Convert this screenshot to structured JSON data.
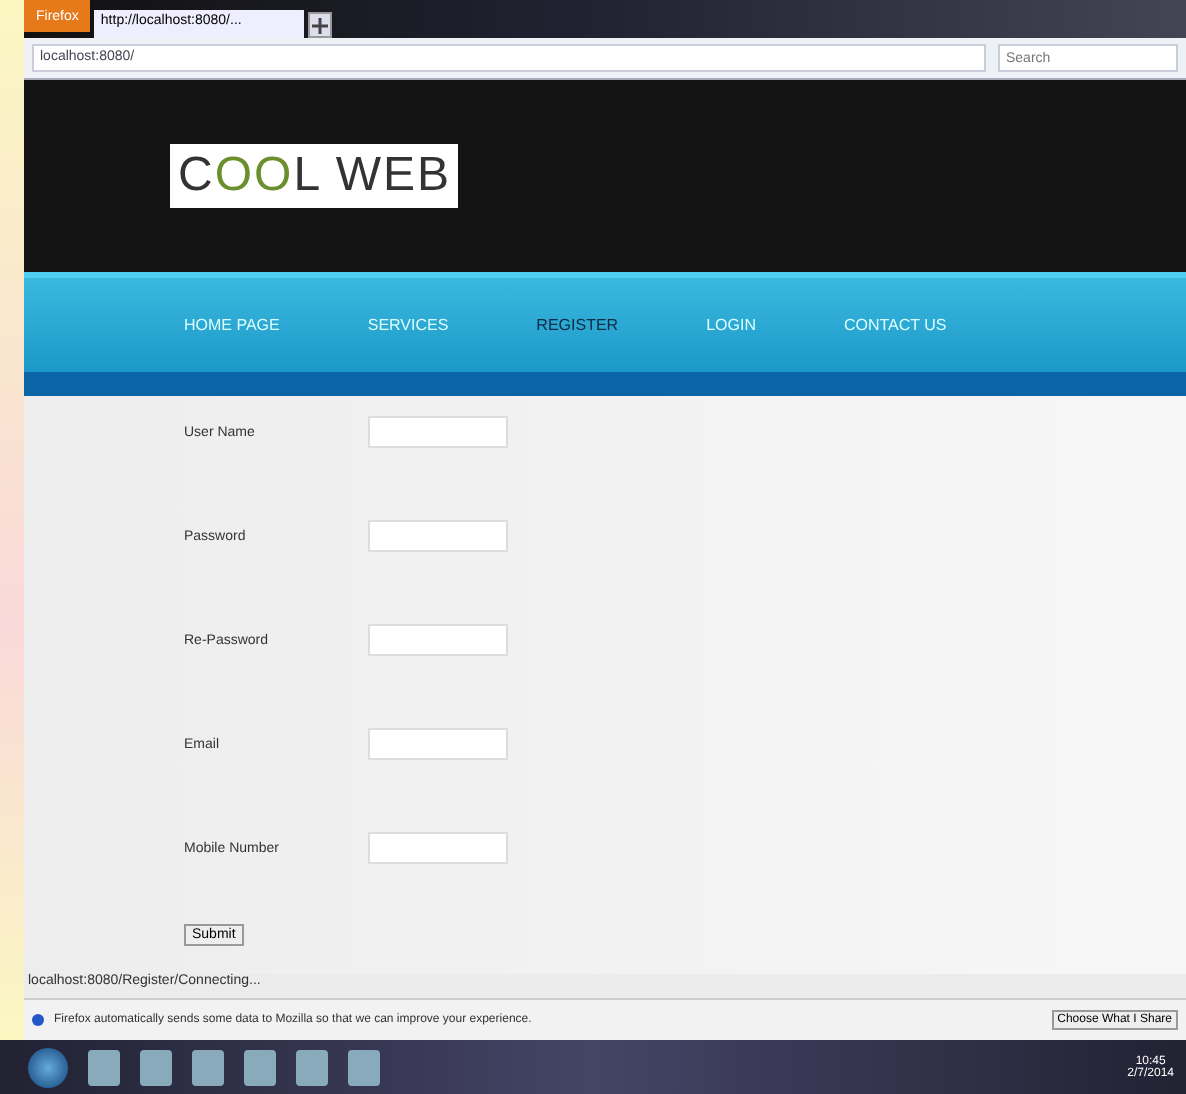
{
  "browser": {
    "menu_button": "Firefox",
    "tab_title": "http://localhost:8080/...",
    "address": "localhost:8080/",
    "search_placeholder": "Search"
  },
  "logo": {
    "text_start": "C",
    "text_mid": "OO",
    "text_end": "L WEB"
  },
  "nav": [
    {
      "label": "HOME PAGE",
      "selected": false
    },
    {
      "label": "SERVICES",
      "selected": false
    },
    {
      "label": "REGISTER",
      "selected": true
    },
    {
      "label": "LOGIN",
      "selected": false
    },
    {
      "label": "CONTACT US",
      "selected": false
    }
  ],
  "form": {
    "fields": [
      {
        "label": "User Name"
      },
      {
        "label": "Password"
      },
      {
        "label": "Re-Password"
      },
      {
        "label": "Email"
      },
      {
        "label": "Mobile Number"
      }
    ],
    "submit": "Submit"
  },
  "status_bar": "localhost:8080/Register/Connecting...",
  "notification": {
    "text": "Firefox automatically sends some data to Mozilla so that we can improve your experience.",
    "button": "Choose What I Share"
  },
  "taskbar": {
    "time": "10:45",
    "date": "2/7/2014"
  }
}
